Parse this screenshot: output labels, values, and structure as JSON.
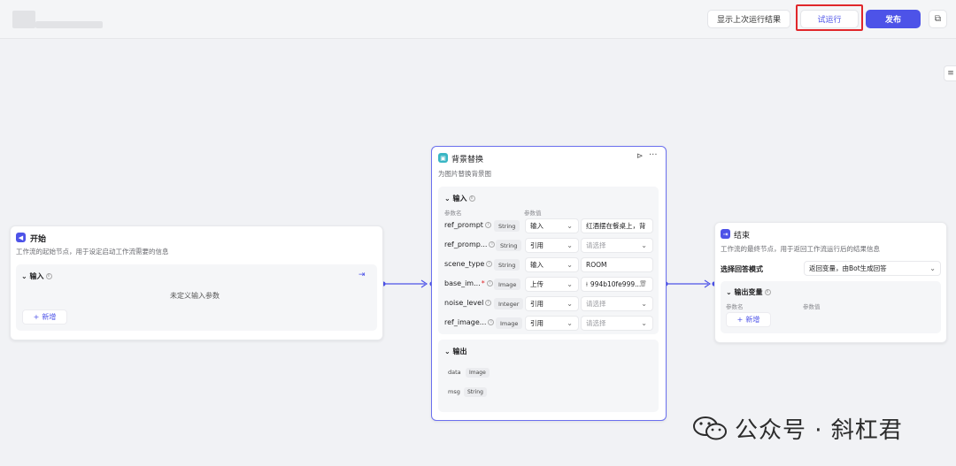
{
  "header": {
    "show_last_result_label": "显示上次运行结果",
    "trial_run_label": "试运行",
    "publish_label": "发布"
  },
  "colors": {
    "accent": "#4d53e8",
    "highlight": "#e0272b",
    "end_node_icon": "#4d53e8",
    "start_node_icon": "#4d53e8",
    "bg_node_icon": "#39b6c4"
  },
  "start_node": {
    "title": "开始",
    "description": "工作流的起始节点，用于设定启动工作流需要的信息",
    "input_section": "输入",
    "empty_text": "未定义输入参数",
    "add_label": "新增",
    "icon": "play-icon"
  },
  "bg_node": {
    "title": "背景替换",
    "description": "为图片替换背景图",
    "input_section": "输入",
    "col_param_name": "参数名",
    "col_param_value": "参数值",
    "params": [
      {
        "name": "ref_prompt",
        "type": "String",
        "source": "输入",
        "value": "红酒摆在餐桌上，背",
        "placeholder": false,
        "has_chevron": false
      },
      {
        "name": "ref_promp...",
        "type": "String",
        "source": "引用",
        "value": "请选择",
        "placeholder": true,
        "has_chevron": true
      },
      {
        "name": "scene_type",
        "type": "String",
        "source": "输入",
        "value": "ROOM",
        "placeholder": false,
        "has_chevron": false
      },
      {
        "name": "base_im...",
        "type": "Image",
        "source": "上传",
        "value": "994b10fe999...",
        "placeholder": false,
        "has_chevron": false,
        "required": true
      },
      {
        "name": "noise_level",
        "type": "Integer",
        "source": "引用",
        "value": "请选择",
        "placeholder": true,
        "has_chevron": true
      },
      {
        "name": "ref_image...",
        "type": "Image",
        "source": "引用",
        "value": "请选择",
        "placeholder": true,
        "has_chevron": true
      }
    ],
    "output_section": "输出",
    "outputs": [
      {
        "name": "data",
        "type": "Image"
      },
      {
        "name": "msg",
        "type": "String"
      }
    ]
  },
  "end_node": {
    "title": "结束",
    "description": "工作流的最终节点，用于返回工作流运行后的结果信息",
    "mode_label": "选择回答模式",
    "mode_value": "返回变量，由Bot生成回答",
    "output_section": "输出变量",
    "col_param_name": "参数名",
    "col_param_value": "参数值",
    "add_label": "新增"
  },
  "watermark": {
    "text": "公众号 · 斜杠君"
  }
}
